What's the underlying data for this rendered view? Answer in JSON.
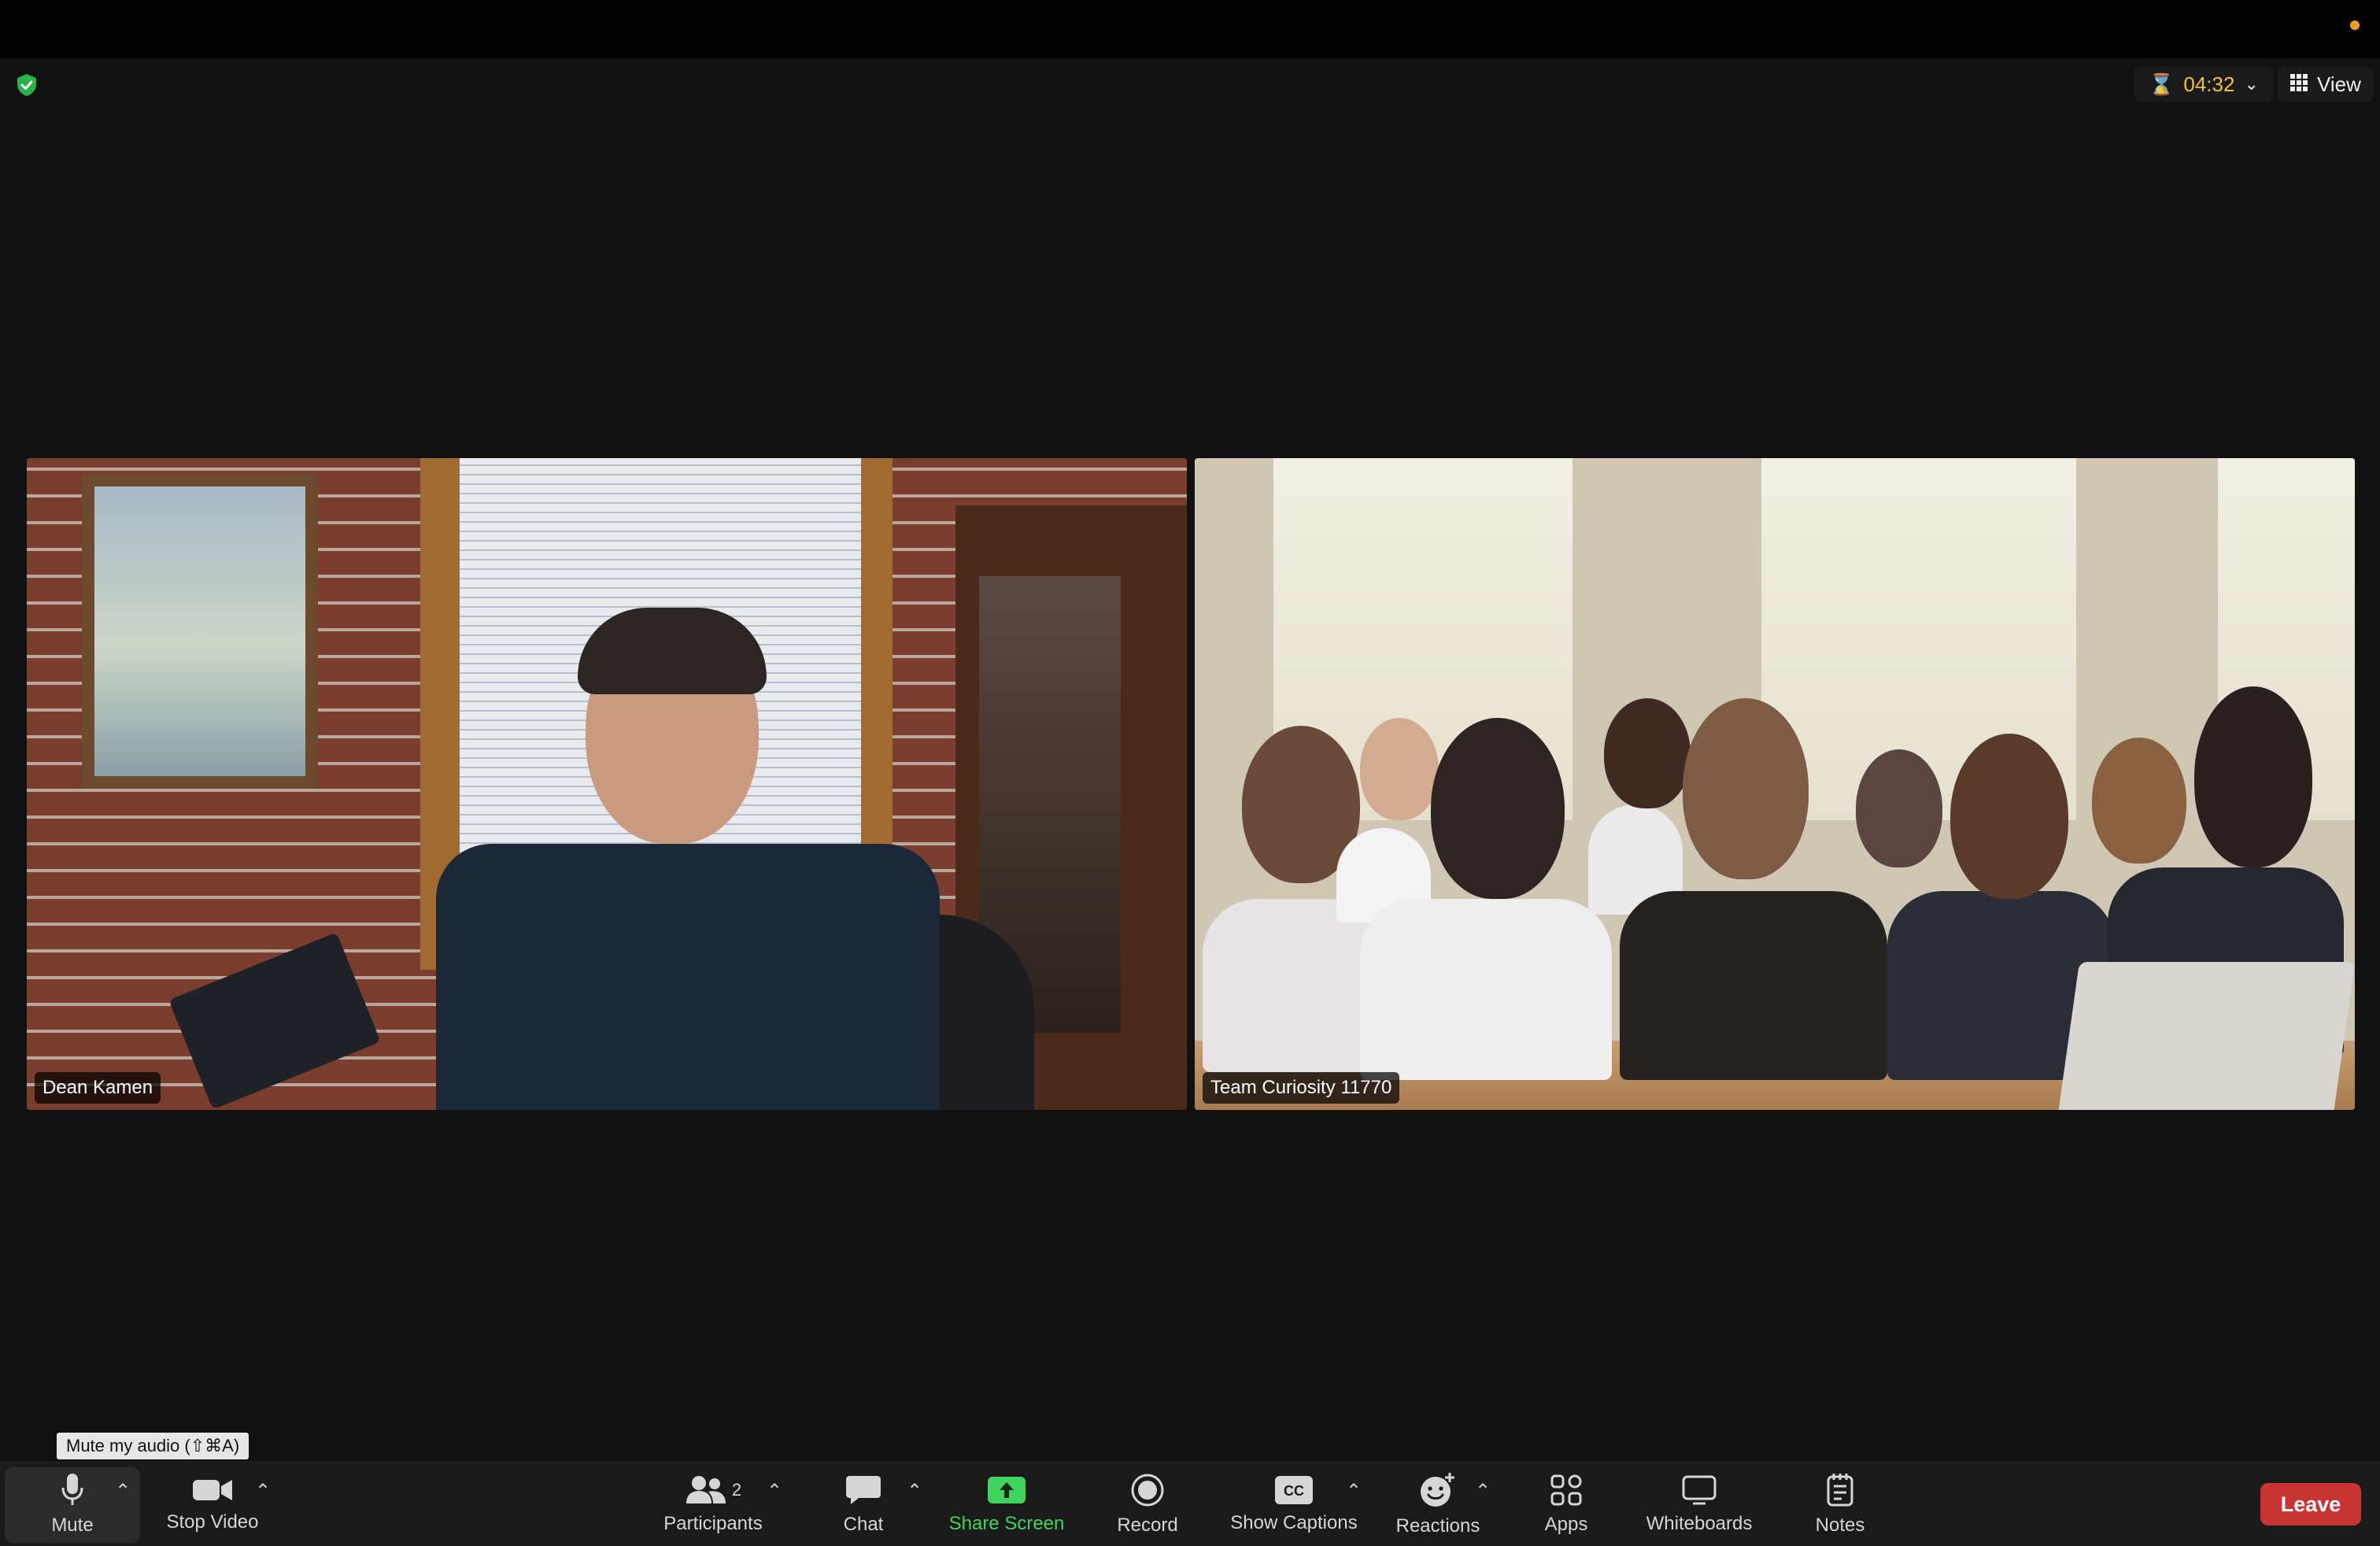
{
  "topbar": {
    "timer": "04:32",
    "view_label": "View"
  },
  "participants": [
    {
      "name": "Dean Kamen"
    },
    {
      "name": "Team Curiosity 11770"
    }
  ],
  "tooltip": "Mute my audio (⇧⌘A)",
  "toolbar": {
    "mute": "Mute",
    "stop_video": "Stop Video",
    "participants": "Participants",
    "participants_count": "2",
    "chat": "Chat",
    "share_screen": "Share Screen",
    "record": "Record",
    "show_captions": "Show Captions",
    "reactions": "Reactions",
    "apps": "Apps",
    "whiteboards": "Whiteboards",
    "notes": "Notes",
    "leave": "Leave"
  },
  "colors": {
    "background": "#111111",
    "toolbar": "#1a1a1a",
    "timer": "#f2c230",
    "share_green": "#3fd45e",
    "leave_red": "#c83434",
    "security_green": "#28b44a"
  }
}
